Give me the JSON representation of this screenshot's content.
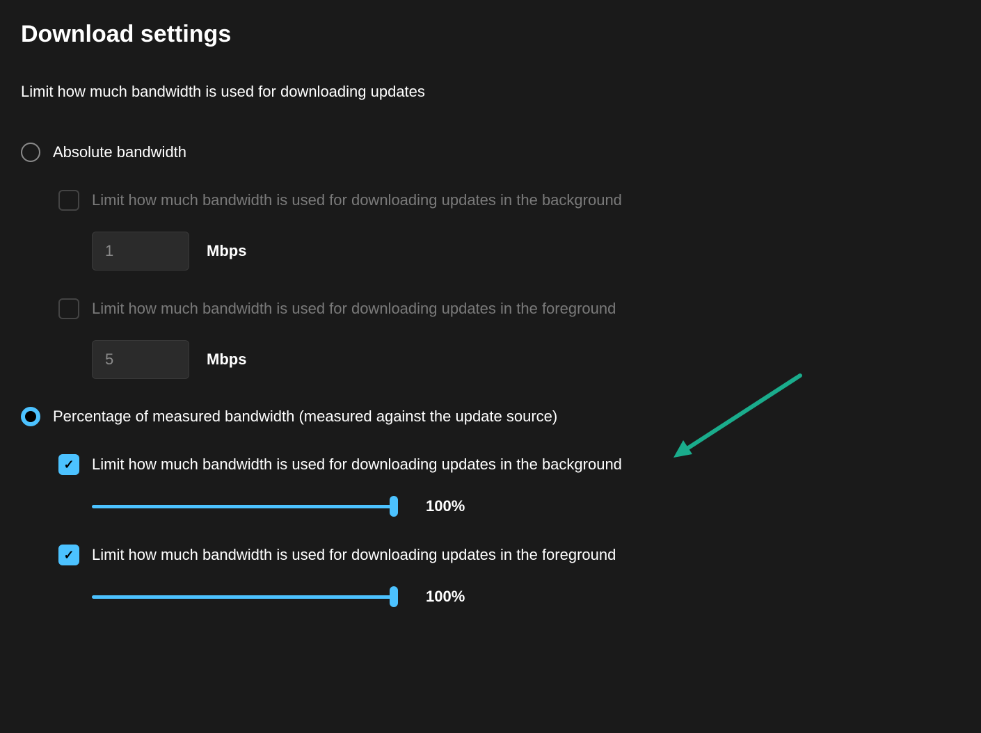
{
  "title": "Download settings",
  "subtitle": "Limit how much bandwidth is used for downloading updates",
  "absolute": {
    "label": "Absolute bandwidth",
    "selected": false,
    "background": {
      "label": "Limit how much bandwidth is used for downloading updates in the background",
      "checked": false,
      "value": "1",
      "unit": "Mbps"
    },
    "foreground": {
      "label": "Limit how much bandwidth is used for downloading updates in the foreground",
      "checked": false,
      "value": "5",
      "unit": "Mbps"
    }
  },
  "percentage": {
    "label": "Percentage of measured bandwidth (measured against the update source)",
    "selected": true,
    "background": {
      "label": "Limit how much bandwidth is used for downloading updates in the background",
      "checked": true,
      "value": "100%"
    },
    "foreground": {
      "label": "Limit how much bandwidth is used for downloading updates in the foreground",
      "checked": true,
      "value": "100%"
    }
  },
  "colors": {
    "accent": "#4cc2ff",
    "background": "#1a1a1a",
    "arrow": "#1aac8c"
  }
}
